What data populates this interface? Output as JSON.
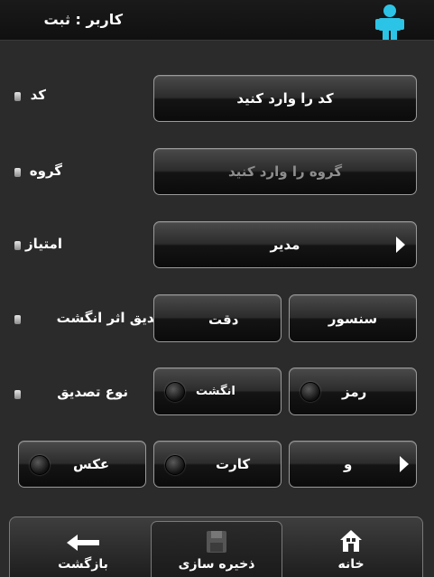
{
  "header": {
    "title": "کاربر : ثبت",
    "icon": "user-icon"
  },
  "form": {
    "code": {
      "label": "کد",
      "placeholder": "کد را وارد کنید"
    },
    "group": {
      "label": "گروه",
      "placeholder": "گروه را وارد کنید"
    },
    "privilege": {
      "label": "امتیاز",
      "value": "مدیر"
    },
    "fingerprint_verification": {
      "label": "تصدیق اثر انگشت",
      "options": [
        "سنسور",
        "دقت"
      ]
    },
    "verification_type": {
      "label": "نوع تصدیق",
      "options": [
        "رمز",
        "انگشت"
      ]
    },
    "verification_combo": {
      "options": [
        "و",
        "کارت",
        "عکس"
      ]
    }
  },
  "footer": {
    "items": [
      {
        "label": "خانه",
        "icon": "home-icon"
      },
      {
        "label": "ذخیره سازی",
        "icon": "save-icon"
      },
      {
        "label": "بازگشت",
        "icon": "back-arrow-icon"
      }
    ]
  },
  "colors": {
    "background": "#2b2b2b",
    "accent": "#2bc4e6",
    "placeholder_text": "#8e8e8e"
  }
}
